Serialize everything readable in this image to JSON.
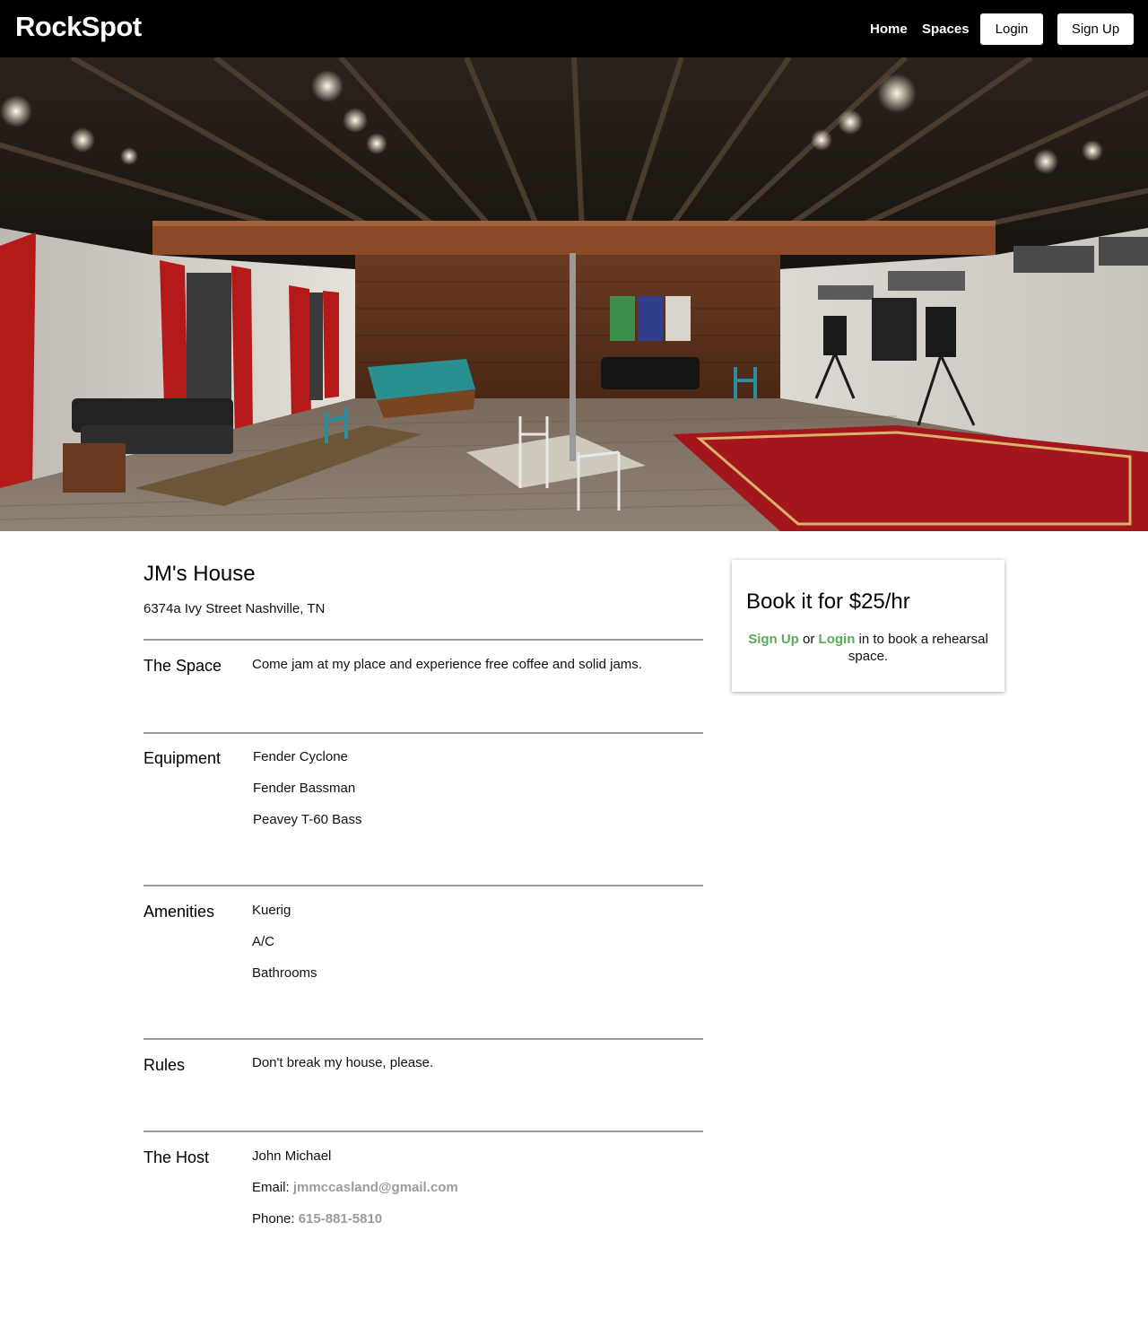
{
  "nav": {
    "brand": "RockSpot",
    "links": [
      "Home",
      "Spaces"
    ],
    "login_label": "Login",
    "signup_label": "Sign Up"
  },
  "space": {
    "title": "JM's House",
    "address": "6374a Ivy Street Nashville, TN",
    "sections": {
      "the_space": {
        "label": "The Space",
        "text": "Come jam at my place and experience free coffee and solid jams."
      },
      "equipment": {
        "label": "Equipment",
        "items": [
          "Fender Cyclone",
          "Fender Bassman",
          "Peavey T-60 Bass"
        ]
      },
      "amenities": {
        "label": "Amenities",
        "items": [
          "Kuerig",
          "A/C",
          "Bathrooms"
        ]
      },
      "rules": {
        "label": "Rules",
        "text": "Don't break my house, please."
      },
      "host": {
        "label": "The Host",
        "name": "John Michael",
        "email_label": "Email:",
        "email": "jmmccasland@gmail.com",
        "phone_label": "Phone:",
        "phone": "615-881-5810"
      }
    }
  },
  "booking": {
    "title": "Book it for $25/hr",
    "signup_link": "Sign Up",
    "or_text": "or",
    "login_link": "Login",
    "suffix_text": "in to book a rehearsal space."
  },
  "colors": {
    "nav_bg": "#000000",
    "link_green": "#57ad57",
    "link_grey": "#9b9b9b",
    "divider": "#999999"
  }
}
